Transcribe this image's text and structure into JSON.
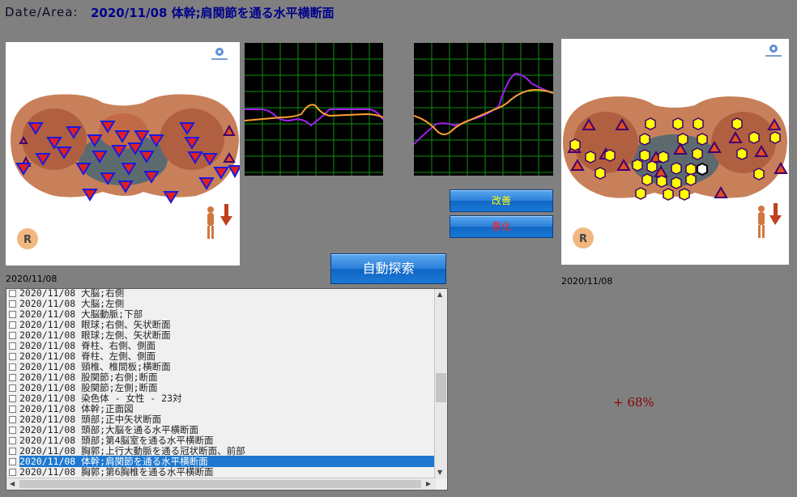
{
  "header": {
    "label": "Date/Area:",
    "title": "2020/11/08 体幹;肩関節を通る水平横断面"
  },
  "left_panel": {
    "date": "2020/11/08",
    "side_marker": "R"
  },
  "right_panel": {
    "date": "2020/11/08",
    "side_marker": "R"
  },
  "buttons": {
    "improve": "改善",
    "worsen": "悪化",
    "auto_search": "自動探索"
  },
  "result": {
    "percent": "+ 68%"
  },
  "colors": {
    "purple_line": "#a020f0",
    "orange_line": "#ffa030",
    "grid": "#0f8f0f",
    "marker_blue": "#1a1ae0",
    "marker_yellow": "#ffff00"
  },
  "list": {
    "items": [
      {
        "text": "2020/11/08 大脳;右側",
        "selected": false
      },
      {
        "text": "2020/11/08 大脳;左側",
        "selected": false
      },
      {
        "text": "2020/11/08 大脳動脈;下部",
        "selected": false
      },
      {
        "text": "2020/11/08 眼球;右側、矢状断面",
        "selected": false
      },
      {
        "text": "2020/11/08 眼球;左側、矢状断面",
        "selected": false
      },
      {
        "text": "2020/11/08 脊柱、右側、側面",
        "selected": false
      },
      {
        "text": "2020/11/08 脊柱、左側、側面",
        "selected": false
      },
      {
        "text": "2020/11/08 頸椎、椎間板;横断面",
        "selected": false
      },
      {
        "text": "2020/11/08 股関節;右側;断面",
        "selected": false
      },
      {
        "text": "2020/11/08 股関節;左側;断面",
        "selected": false
      },
      {
        "text": "2020/11/08 染色体 - 女性 - 23対",
        "selected": false
      },
      {
        "text": "2020/11/08 体幹;正面図",
        "selected": false
      },
      {
        "text": "2020/11/08 頭部;正中矢状断面",
        "selected": false
      },
      {
        "text": "2020/11/08 頭部;大脳を通る水平横断面",
        "selected": false
      },
      {
        "text": "2020/11/08 頭部;第4脳室を通る水平横断面",
        "selected": false
      },
      {
        "text": "2020/11/08 胸郭;上行大動脈を通る冠状断面、前部",
        "selected": false
      },
      {
        "text": "2020/11/08 体幹;肩関節を通る水平横断面",
        "selected": true
      },
      {
        "text": "2020/11/08 胸郭;第6胸椎を通る水平横断面",
        "selected": false
      }
    ]
  }
}
